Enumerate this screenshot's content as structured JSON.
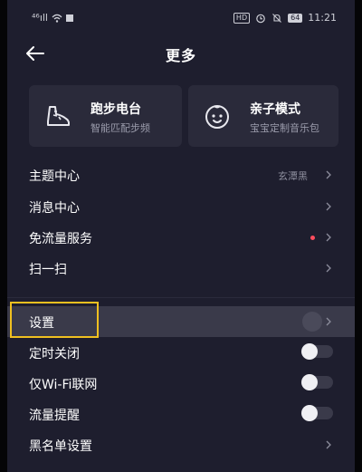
{
  "status_bar": {
    "signal": "⁴⁶ıll",
    "hd_badge": "HD",
    "battery": "64",
    "time": "11:21"
  },
  "header": {
    "title": "更多"
  },
  "cards": [
    {
      "title": "跑步电台",
      "subtitle": "智能匹配步频",
      "icon": "running-shoe-icon"
    },
    {
      "title": "亲子模式",
      "subtitle": "宝宝定制音乐包",
      "icon": "baby-face-icon"
    }
  ],
  "menu": {
    "theme": {
      "label": "主题中心",
      "value": "玄潭黑"
    },
    "messages": {
      "label": "消息中心"
    },
    "free_data": {
      "label": "免流量服务"
    },
    "scan": {
      "label": "扫一扫"
    },
    "settings": {
      "label": "设置"
    },
    "timer": {
      "label": "定时关闭",
      "enabled": false
    },
    "wifi_only": {
      "label": "仅Wi-Fi联网",
      "enabled": false
    },
    "data_alert": {
      "label": "流量提醒",
      "enabled": false
    },
    "blacklist": {
      "label": "黑名单设置"
    }
  },
  "colors": {
    "background": "#1e1e2e",
    "card": "#2a2a3a",
    "highlight_box": "#f0c020",
    "red_dot": "#ff4d5e"
  }
}
